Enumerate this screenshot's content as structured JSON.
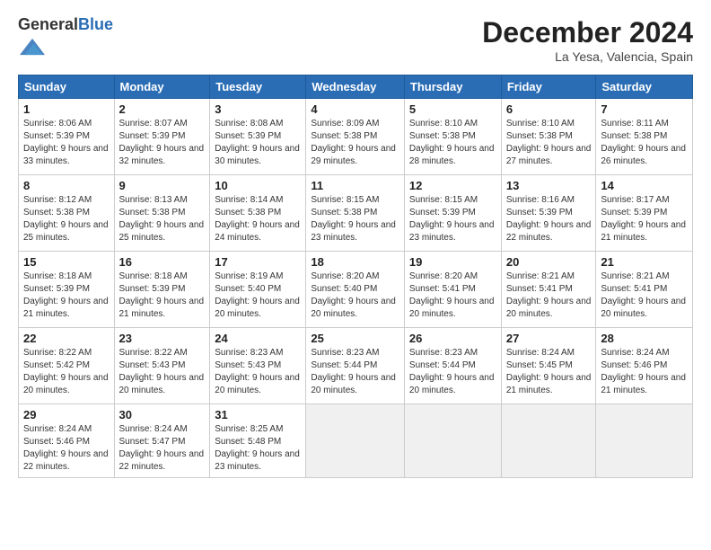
{
  "header": {
    "logo_general": "General",
    "logo_blue": "Blue",
    "month": "December 2024",
    "location": "La Yesa, Valencia, Spain"
  },
  "weekdays": [
    "Sunday",
    "Monday",
    "Tuesday",
    "Wednesday",
    "Thursday",
    "Friday",
    "Saturday"
  ],
  "weeks": [
    [
      {
        "day": "1",
        "sunrise": "Sunrise: 8:06 AM",
        "sunset": "Sunset: 5:39 PM",
        "daylight": "Daylight: 9 hours and 33 minutes."
      },
      {
        "day": "2",
        "sunrise": "Sunrise: 8:07 AM",
        "sunset": "Sunset: 5:39 PM",
        "daylight": "Daylight: 9 hours and 32 minutes."
      },
      {
        "day": "3",
        "sunrise": "Sunrise: 8:08 AM",
        "sunset": "Sunset: 5:39 PM",
        "daylight": "Daylight: 9 hours and 30 minutes."
      },
      {
        "day": "4",
        "sunrise": "Sunrise: 8:09 AM",
        "sunset": "Sunset: 5:38 PM",
        "daylight": "Daylight: 9 hours and 29 minutes."
      },
      {
        "day": "5",
        "sunrise": "Sunrise: 8:10 AM",
        "sunset": "Sunset: 5:38 PM",
        "daylight": "Daylight: 9 hours and 28 minutes."
      },
      {
        "day": "6",
        "sunrise": "Sunrise: 8:10 AM",
        "sunset": "Sunset: 5:38 PM",
        "daylight": "Daylight: 9 hours and 27 minutes."
      },
      {
        "day": "7",
        "sunrise": "Sunrise: 8:11 AM",
        "sunset": "Sunset: 5:38 PM",
        "daylight": "Daylight: 9 hours and 26 minutes."
      }
    ],
    [
      {
        "day": "8",
        "sunrise": "Sunrise: 8:12 AM",
        "sunset": "Sunset: 5:38 PM",
        "daylight": "Daylight: 9 hours and 25 minutes."
      },
      {
        "day": "9",
        "sunrise": "Sunrise: 8:13 AM",
        "sunset": "Sunset: 5:38 PM",
        "daylight": "Daylight: 9 hours and 25 minutes."
      },
      {
        "day": "10",
        "sunrise": "Sunrise: 8:14 AM",
        "sunset": "Sunset: 5:38 PM",
        "daylight": "Daylight: 9 hours and 24 minutes."
      },
      {
        "day": "11",
        "sunrise": "Sunrise: 8:15 AM",
        "sunset": "Sunset: 5:38 PM",
        "daylight": "Daylight: 9 hours and 23 minutes."
      },
      {
        "day": "12",
        "sunrise": "Sunrise: 8:15 AM",
        "sunset": "Sunset: 5:39 PM",
        "daylight": "Daylight: 9 hours and 23 minutes."
      },
      {
        "day": "13",
        "sunrise": "Sunrise: 8:16 AM",
        "sunset": "Sunset: 5:39 PM",
        "daylight": "Daylight: 9 hours and 22 minutes."
      },
      {
        "day": "14",
        "sunrise": "Sunrise: 8:17 AM",
        "sunset": "Sunset: 5:39 PM",
        "daylight": "Daylight: 9 hours and 21 minutes."
      }
    ],
    [
      {
        "day": "15",
        "sunrise": "Sunrise: 8:18 AM",
        "sunset": "Sunset: 5:39 PM",
        "daylight": "Daylight: 9 hours and 21 minutes."
      },
      {
        "day": "16",
        "sunrise": "Sunrise: 8:18 AM",
        "sunset": "Sunset: 5:39 PM",
        "daylight": "Daylight: 9 hours and 21 minutes."
      },
      {
        "day": "17",
        "sunrise": "Sunrise: 8:19 AM",
        "sunset": "Sunset: 5:40 PM",
        "daylight": "Daylight: 9 hours and 20 minutes."
      },
      {
        "day": "18",
        "sunrise": "Sunrise: 8:20 AM",
        "sunset": "Sunset: 5:40 PM",
        "daylight": "Daylight: 9 hours and 20 minutes."
      },
      {
        "day": "19",
        "sunrise": "Sunrise: 8:20 AM",
        "sunset": "Sunset: 5:41 PM",
        "daylight": "Daylight: 9 hours and 20 minutes."
      },
      {
        "day": "20",
        "sunrise": "Sunrise: 8:21 AM",
        "sunset": "Sunset: 5:41 PM",
        "daylight": "Daylight: 9 hours and 20 minutes."
      },
      {
        "day": "21",
        "sunrise": "Sunrise: 8:21 AM",
        "sunset": "Sunset: 5:41 PM",
        "daylight": "Daylight: 9 hours and 20 minutes."
      }
    ],
    [
      {
        "day": "22",
        "sunrise": "Sunrise: 8:22 AM",
        "sunset": "Sunset: 5:42 PM",
        "daylight": "Daylight: 9 hours and 20 minutes."
      },
      {
        "day": "23",
        "sunrise": "Sunrise: 8:22 AM",
        "sunset": "Sunset: 5:43 PM",
        "daylight": "Daylight: 9 hours and 20 minutes."
      },
      {
        "day": "24",
        "sunrise": "Sunrise: 8:23 AM",
        "sunset": "Sunset: 5:43 PM",
        "daylight": "Daylight: 9 hours and 20 minutes."
      },
      {
        "day": "25",
        "sunrise": "Sunrise: 8:23 AM",
        "sunset": "Sunset: 5:44 PM",
        "daylight": "Daylight: 9 hours and 20 minutes."
      },
      {
        "day": "26",
        "sunrise": "Sunrise: 8:23 AM",
        "sunset": "Sunset: 5:44 PM",
        "daylight": "Daylight: 9 hours and 20 minutes."
      },
      {
        "day": "27",
        "sunrise": "Sunrise: 8:24 AM",
        "sunset": "Sunset: 5:45 PM",
        "daylight": "Daylight: 9 hours and 21 minutes."
      },
      {
        "day": "28",
        "sunrise": "Sunrise: 8:24 AM",
        "sunset": "Sunset: 5:46 PM",
        "daylight": "Daylight: 9 hours and 21 minutes."
      }
    ],
    [
      {
        "day": "29",
        "sunrise": "Sunrise: 8:24 AM",
        "sunset": "Sunset: 5:46 PM",
        "daylight": "Daylight: 9 hours and 22 minutes."
      },
      {
        "day": "30",
        "sunrise": "Sunrise: 8:24 AM",
        "sunset": "Sunset: 5:47 PM",
        "daylight": "Daylight: 9 hours and 22 minutes."
      },
      {
        "day": "31",
        "sunrise": "Sunrise: 8:25 AM",
        "sunset": "Sunset: 5:48 PM",
        "daylight": "Daylight: 9 hours and 23 minutes."
      },
      null,
      null,
      null,
      null
    ]
  ]
}
